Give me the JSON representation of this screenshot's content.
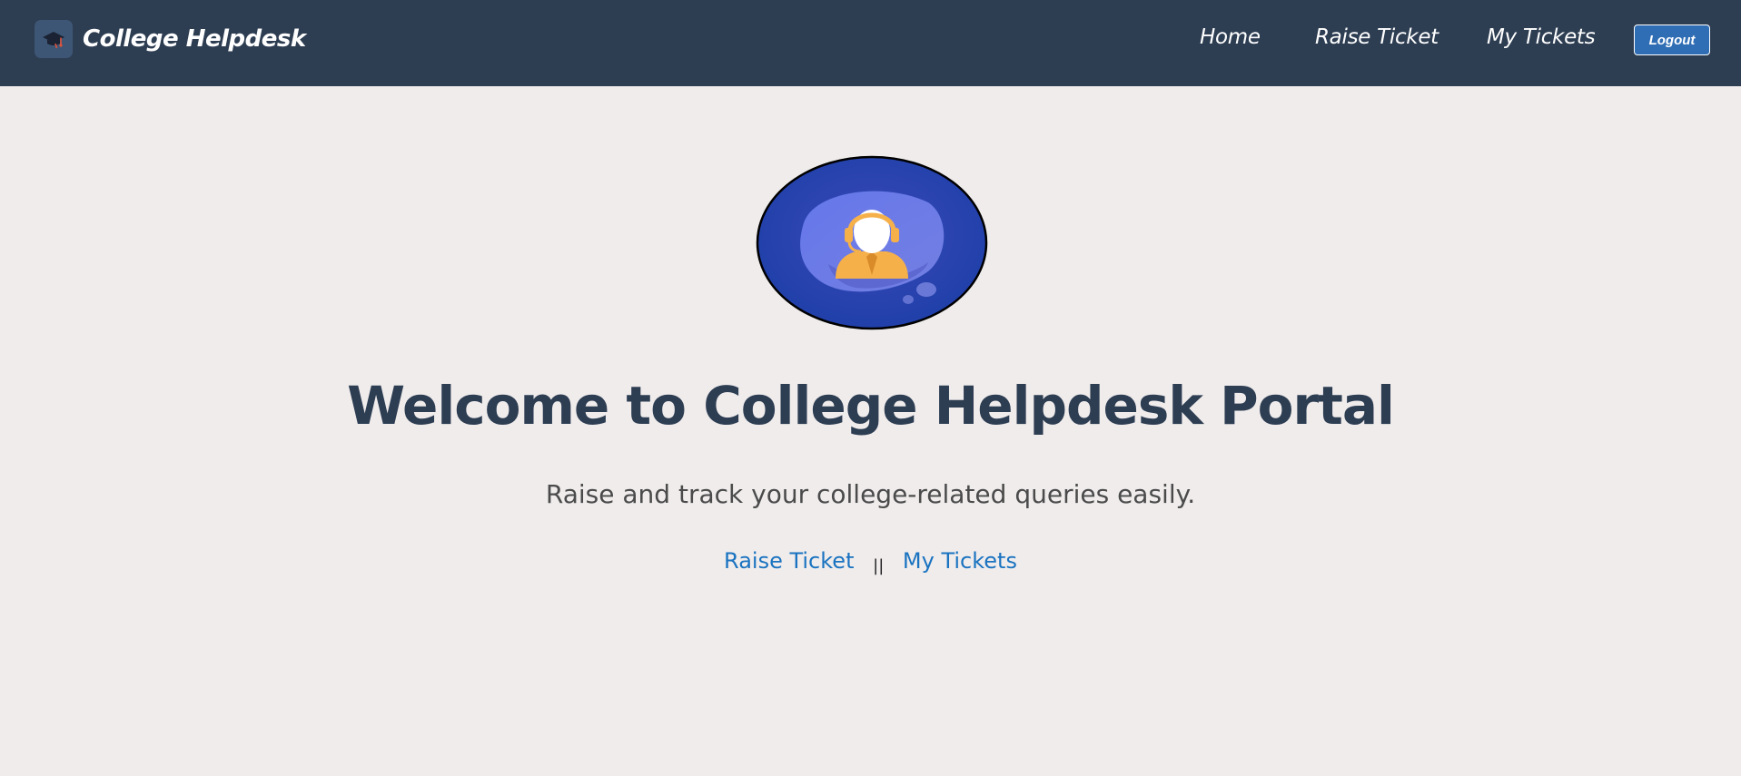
{
  "navbar": {
    "brand_name": "College Helpdesk",
    "brand_icon": "graduation-cap-icon",
    "links": {
      "home": "Home",
      "raise_ticket": "Raise Ticket",
      "my_tickets": "My Tickets"
    },
    "logout_label": "Logout"
  },
  "hero": {
    "image_icon": "support-agent-headset-icon",
    "title": "Welcome to College Helpdesk Portal",
    "subtitle": "Raise and track your college-related queries easily.",
    "links": {
      "raise_ticket": "Raise Ticket",
      "separator": "||",
      "my_tickets": "My Tickets"
    }
  },
  "colors": {
    "navbar_bg": "#2d3d52",
    "page_bg": "#f0ecec",
    "logout_bg": "#2f6db4",
    "link_color": "#1a73c0",
    "title_color": "#2d3d52"
  }
}
